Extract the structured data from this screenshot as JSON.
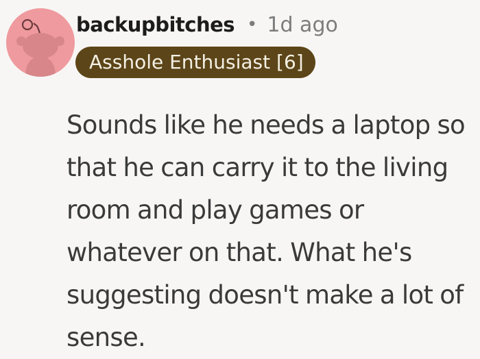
{
  "comment": {
    "author": {
      "username": "backupbitches",
      "avatar_icon": "reddit-snoo-avatar-icon",
      "avatar_color": "#ef9a9e"
    },
    "separator": "•",
    "timestamp": "1d ago",
    "flair": {
      "text": "Asshole Enthusiast [6]",
      "background_color": "#5c4518"
    },
    "body": "Sounds like he needs a laptop so that he can carry it to the living room and play games or whatever on that. What he's suggesting doesn't make a lot of sense."
  }
}
